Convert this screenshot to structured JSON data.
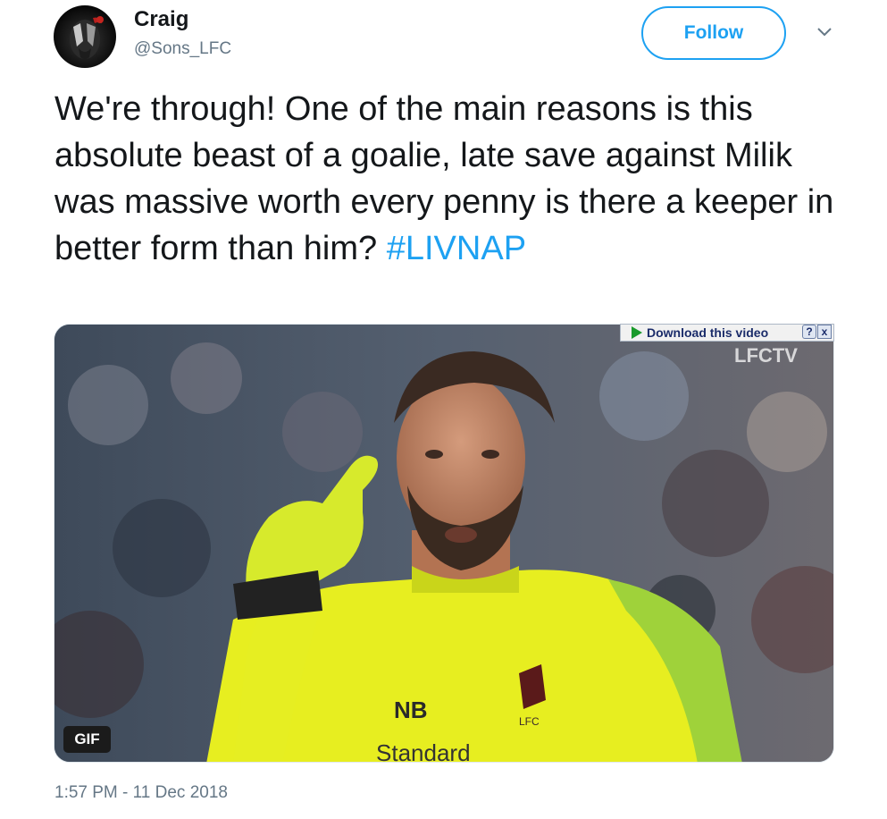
{
  "author": {
    "name": "Craig",
    "handle": "@Sons_LFC",
    "avatar_icon": "avatar-icon"
  },
  "actions": {
    "follow_label": "Follow",
    "more_icon": "chevron-down-icon"
  },
  "tweet": {
    "text": "We're through! One of the main reasons is this absolute beast of a goalie, late save against Milik was massive worth every penny is there a keeper in better form than him?",
    "hashtag": "#LIVNAP",
    "timestamp": "1:57 PM - 11 Dec 2018"
  },
  "media": {
    "type_badge": "GIF",
    "download_label": "Download this video",
    "help_label": "?",
    "close_label": "x",
    "watermark": "LFCTV",
    "shirt_logo": "LFC",
    "sponsor_text": "Standard"
  },
  "colors": {
    "accent": "#1da1f2",
    "text": "#14171a",
    "muted": "#657786",
    "jersey": "#e9f01c"
  }
}
